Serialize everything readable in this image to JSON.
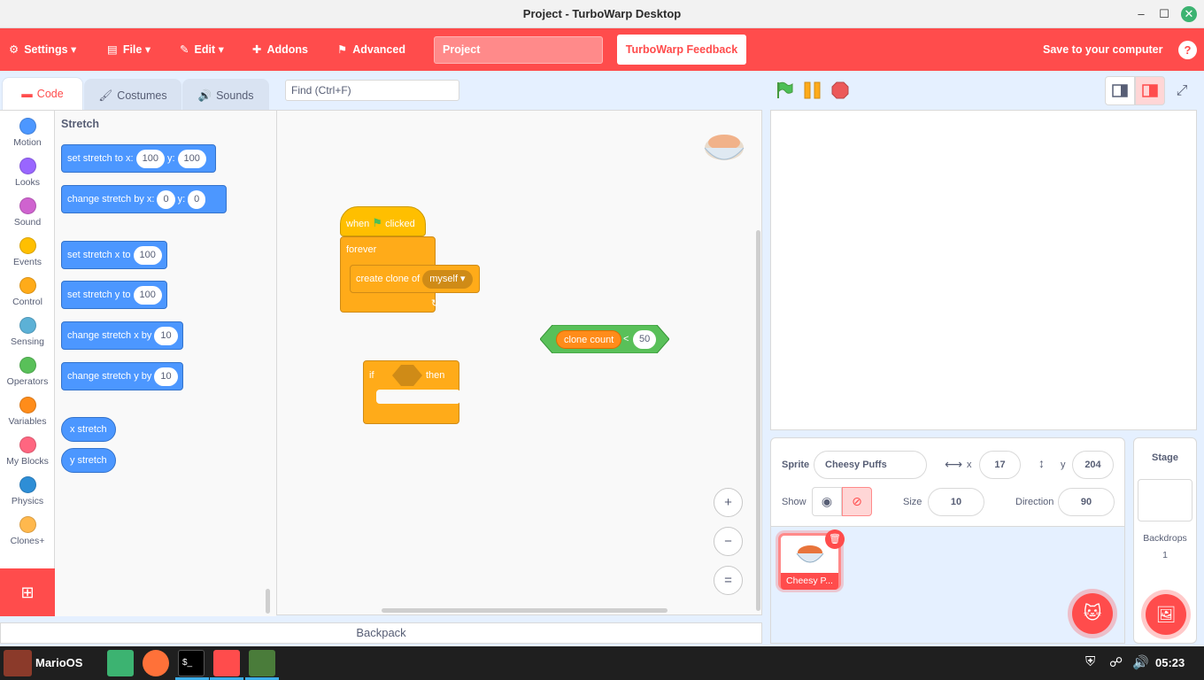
{
  "window": {
    "title": "Project - TurboWarp Desktop"
  },
  "menu": {
    "settings": "Settings",
    "file": "File",
    "edit": "Edit",
    "addons": "Addons",
    "advanced": "Advanced",
    "project_title": "Project",
    "feedback": "TurboWarp Feedback",
    "save": "Save to your computer",
    "help": "?"
  },
  "tabs": {
    "code": "Code",
    "costumes": "Costumes",
    "sounds": "Sounds"
  },
  "find": {
    "placeholder": "Find (Ctrl+F)"
  },
  "categories": [
    {
      "label": "Motion",
      "color": "#4c97ff"
    },
    {
      "label": "Looks",
      "color": "#9966ff"
    },
    {
      "label": "Sound",
      "color": "#cf63cf"
    },
    {
      "label": "Events",
      "color": "#ffbf00"
    },
    {
      "label": "Control",
      "color": "#ffab19"
    },
    {
      "label": "Sensing",
      "color": "#5cb1d6"
    },
    {
      "label": "Operators",
      "color": "#59c059"
    },
    {
      "label": "Variables",
      "color": "#ff8c1a"
    },
    {
      "label": "My Blocks",
      "color": "#ff6680"
    },
    {
      "label": "Physics",
      "color": "#2e8ed6"
    },
    {
      "label": "Clones+",
      "color": "#ffb84d"
    }
  ],
  "palette": {
    "heading": "Stretch",
    "set_stretch": {
      "label": "set stretch to x:",
      "x": "100",
      "ylabel": "y:",
      "y": "100"
    },
    "change_stretch": {
      "label": "change stretch by x:",
      "x": "0",
      "ylabel": "y:",
      "y": "0"
    },
    "set_x": {
      "label": "set stretch x to",
      "value": "100"
    },
    "set_y": {
      "label": "set stretch y to",
      "value": "100"
    },
    "change_x": {
      "label": "change stretch x by",
      "value": "10"
    },
    "change_y": {
      "label": "change stretch y by",
      "value": "10"
    },
    "rep_x": "x stretch",
    "rep_y": "y stretch"
  },
  "script": {
    "when": "when",
    "clicked": "clicked",
    "forever": "forever",
    "create_clone": "create clone of",
    "myself": "myself",
    "clone_count": "clone count",
    "lt": "<",
    "limit": "50",
    "if": "if",
    "then": "then"
  },
  "zoom": {
    "in": "+",
    "out": "−",
    "reset": "="
  },
  "backpack": "Backpack",
  "sprite_info": {
    "sprite_label": "Sprite",
    "name": "Cheesy Puffs",
    "x_label": "x",
    "x": "17",
    "y_label": "y",
    "y": "204",
    "show_label": "Show",
    "size_label": "Size",
    "size": "10",
    "direction_label": "Direction",
    "direction": "90"
  },
  "sprite_list": [
    {
      "name": "Cheesy P..."
    }
  ],
  "stage_pane": {
    "title": "Stage",
    "backdrops_label": "Backdrops",
    "backdrops_count": "1"
  },
  "taskbar": {
    "start": "MarioOS",
    "time": "05:23"
  }
}
